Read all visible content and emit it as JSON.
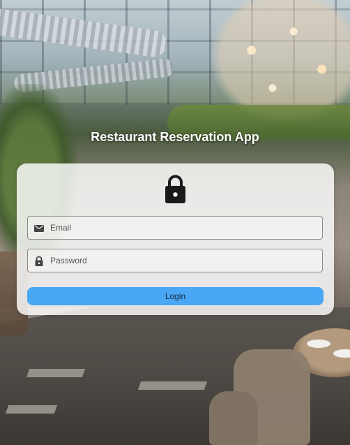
{
  "app": {
    "title": "Restaurant Reservation App"
  },
  "login_form": {
    "email_placeholder": "Email",
    "email_value": "",
    "password_placeholder": "Password",
    "password_value": "",
    "login_label": "Login"
  },
  "icons": {
    "header_icon": "lock-icon",
    "email_icon": "mail-icon",
    "password_icon": "lock-icon"
  },
  "colors": {
    "login_button": "#4aa7f5",
    "card_background": "rgba(255,255,255,0.82)",
    "title_text": "#ffffff"
  }
}
